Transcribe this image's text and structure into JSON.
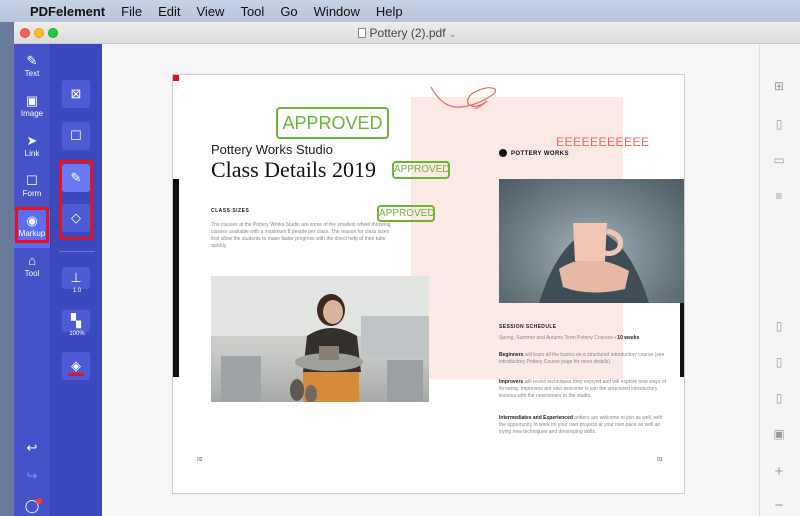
{
  "menubar": {
    "app_name": "PDFelement",
    "items": [
      "File",
      "Edit",
      "View",
      "Tool",
      "Go",
      "Window",
      "Help"
    ]
  },
  "window": {
    "title": "Pottery (2).pdf"
  },
  "left_tools": [
    {
      "label": "Text",
      "icon": "pencil-icon"
    },
    {
      "label": "Image",
      "icon": "image-icon"
    },
    {
      "label": "Link",
      "icon": "link-icon"
    },
    {
      "label": "Form",
      "icon": "form-icon"
    },
    {
      "label": "Markup",
      "icon": "markup-icon",
      "active": true
    },
    {
      "label": "Tool",
      "icon": "tool-icon"
    }
  ],
  "markup_tools": {
    "stroke_width": "1.0",
    "opacity": "100%"
  },
  "document": {
    "stamp_big": "APPROVED",
    "stamp_small_1": "APPROVED",
    "stamp_small_2": "APPROVED",
    "typed_text": "EEEEEEEEEEE",
    "studio": "Pottery Works Studio",
    "heading": "Class Details 2019",
    "class_sizes_title": "CLASS SIZES",
    "class_sizes_text": "The classes at the Pottery Works Studio are some of the smallest wheel throwing classes available with a maximum 8 people per class. The reason for class sizes that allow the students to make faster progress with the direct help of their tutor quickly.",
    "brand": "POTTERY WORKS",
    "session_title": "SESSION SCHEDULE",
    "session_line": "Spring, Summer and Autumn Term Pottery Courses",
    "session_weeks": "- 10 weeks",
    "beginners_label": "Beginners",
    "beginners_text": "will learn all the basics on a structured introductory course (see introductory Pottery Course page for more details)",
    "improvers_label": "Improvers",
    "improvers_text": "will revisit techniques they enjoyed and will explore new ways of throwing. Improvers are also welcome to join the structured introductory lessons with the newcomers to the studio.",
    "intermediate_label": "Intermediates and Experienced",
    "intermediate_text": "potters are welcome to join as well, with the opportunity to work on your own projects at your own pace as well as trying new techniques and developing skills.",
    "page_left": "02",
    "page_right": "03"
  },
  "colors": {
    "sidebar": "#4552c8",
    "stamp_green": "#6ab437",
    "highlight_red": "#e5121f",
    "typed_text": "#e56b63"
  }
}
